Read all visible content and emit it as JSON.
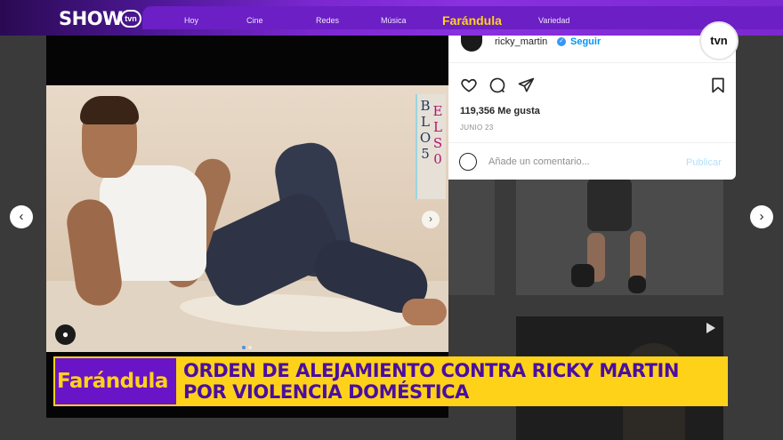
{
  "brand": {
    "logo": "SHOW",
    "logo_badge": "tvn",
    "watermark": "tvn"
  },
  "nav": {
    "items": [
      "Hoy",
      "Cine",
      "Redes",
      "Música",
      "Farándula",
      "Variedad"
    ],
    "active": "Farándula"
  },
  "instagram": {
    "username": "ricky_martin",
    "follow_label": "Seguir",
    "likes": "119,356 Me gusta",
    "date": "JUNIO 23",
    "comment_placeholder": "Añade un comentario...",
    "publish_label": "Publicar"
  },
  "post_photo": {
    "magazine_letters_left": [
      "B",
      "L",
      "O",
      "5"
    ],
    "magazine_letters_right": [
      "E",
      "L",
      "S",
      "0"
    ]
  },
  "lower_third": {
    "section": "Farándula",
    "headline_line1": "ORDEN DE ALEJAMIENTO CONTRA RICKY MARTIN",
    "headline_line2": "POR VIOLENCIA DOMÉSTICA"
  },
  "icons": {
    "prev": "chevron-left-icon",
    "next": "chevron-right-icon",
    "like": "heart-icon",
    "comment": "comment-icon",
    "share": "send-icon",
    "save": "bookmark-icon",
    "emoji": "emoji-icon",
    "account": "user-icon",
    "play": "play-icon"
  },
  "colors": {
    "brand_purple": "#6b1fc4",
    "brand_yellow": "#ffd21a",
    "headline_text": "#4a0ea0",
    "instagram_blue": "#0095f6"
  }
}
